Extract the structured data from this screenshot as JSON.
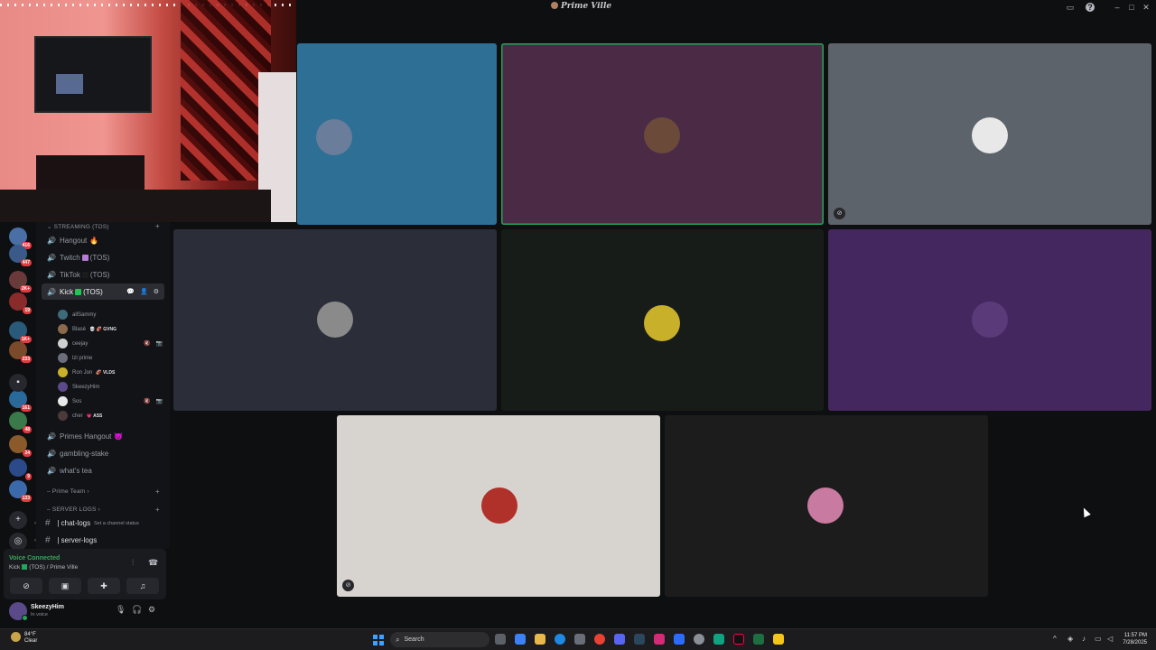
{
  "window": {
    "title": "Prime Ville",
    "controls": [
      "inbox-icon",
      "help-icon",
      "minimize-icon",
      "maximize-icon",
      "close-icon"
    ]
  },
  "servers": {
    "badges": [
      "416",
      "447",
      "2K+",
      "19",
      "1K+",
      "233",
      "161",
      "48",
      "24",
      "9",
      "133"
    ]
  },
  "sidebar": {
    "categories": {
      "streaming": "STREAMING (TOS)",
      "prime_team": "Prime Team",
      "server_logs": "SERVER LOGS"
    },
    "voice_channels": [
      {
        "name": "Hangout",
        "emoji": "🔥",
        "active": false
      },
      {
        "name": "Twitch",
        "suffix": "(TOS)",
        "swatch": "#b57bd6",
        "active": false
      },
      {
        "name": "TikTok",
        "suffix": "(TOS)",
        "swatch": "#1b1b1b",
        "active": false
      },
      {
        "name": "Kick",
        "suffix": "(TOS)",
        "swatch": "#23c552",
        "active": true
      }
    ],
    "active_channel_status": "Set a channel status",
    "voice_users": [
      {
        "name": "allSammy",
        "tag": "",
        "color": "#3e6a7a",
        "icons": ""
      },
      {
        "name": "Blasé",
        "tag": "💀 🏈 GVNG",
        "color": "#8a6a4a",
        "icons": ""
      },
      {
        "name": "ceejay",
        "tag": "",
        "color": "#d0d0d0",
        "icons": "🔇 📷"
      },
      {
        "name": "lzl prime",
        "tag": "",
        "color": "#6a6e78",
        "icons": ""
      },
      {
        "name": "Ron Jon",
        "tag": "🏈 VLDS",
        "color": "#c9b02a",
        "icons": ""
      },
      {
        "name": "SkeezyHim",
        "tag": "",
        "color": "#5a4a8a",
        "icons": ""
      },
      {
        "name": "Sos",
        "tag": "",
        "color": "#e8e8e8",
        "icons": "🔇 📷"
      },
      {
        "name": "cher",
        "tag": "💗 ASS",
        "color": "#4a3a3a",
        "icons": ""
      }
    ],
    "other_channels": [
      {
        "name": "Primes Hangout",
        "emoji": "😈"
      },
      {
        "name": "gambling-stake",
        "emoji": ""
      },
      {
        "name": "what's tea",
        "emoji": ""
      }
    ],
    "text_channels": [
      "chat-logs",
      "server-logs"
    ]
  },
  "voice_panel": {
    "status": "Voice Connected",
    "channel": "Kick",
    "channel_suffix": "(TOS) / Prime Ville",
    "buttons": [
      "camera-off-icon",
      "screen-share-icon",
      "activity-icon",
      "soundboard-icon"
    ]
  },
  "user_panel": {
    "username": "SkeezyHim",
    "status": "In voice"
  },
  "tiles": [
    {
      "id": "tile-1",
      "bg": "#2e6f96",
      "avatar": "#6a7d9a",
      "speaking": false,
      "camera_off": false
    },
    {
      "id": "tile-2",
      "bg": "#4a2a45",
      "avatar": "#6b4a3a",
      "speaking": true,
      "camera_off": false
    },
    {
      "id": "tile-3",
      "bg": "#5d636b",
      "avatar": "#e8e8e8",
      "speaking": false,
      "camera_off": true
    },
    {
      "id": "tile-4",
      "bg": "#2b2d38",
      "avatar": "#8a8a8a",
      "speaking": false,
      "camera_off": false
    },
    {
      "id": "tile-5",
      "bg": "#181c18",
      "avatar": "#c9b02a",
      "speaking": false,
      "camera_off": false
    },
    {
      "id": "tile-6",
      "bg": "#45275f",
      "avatar": "#5b3a7a",
      "speaking": false,
      "camera_off": false
    },
    {
      "id": "tile-7",
      "bg": "#d7d3cf",
      "avatar": "#b0302a",
      "speaking": false,
      "camera_off": true
    },
    {
      "id": "tile-8",
      "bg": "#1c1c1c",
      "avatar": "#c97aa0",
      "speaking": false,
      "camera_off": false
    }
  ],
  "taskbar": {
    "weather_temp": "84°F",
    "weather_desc": "Clear",
    "search_placeholder": "Search",
    "time": "11:57 PM",
    "date": "7/28/2025"
  }
}
